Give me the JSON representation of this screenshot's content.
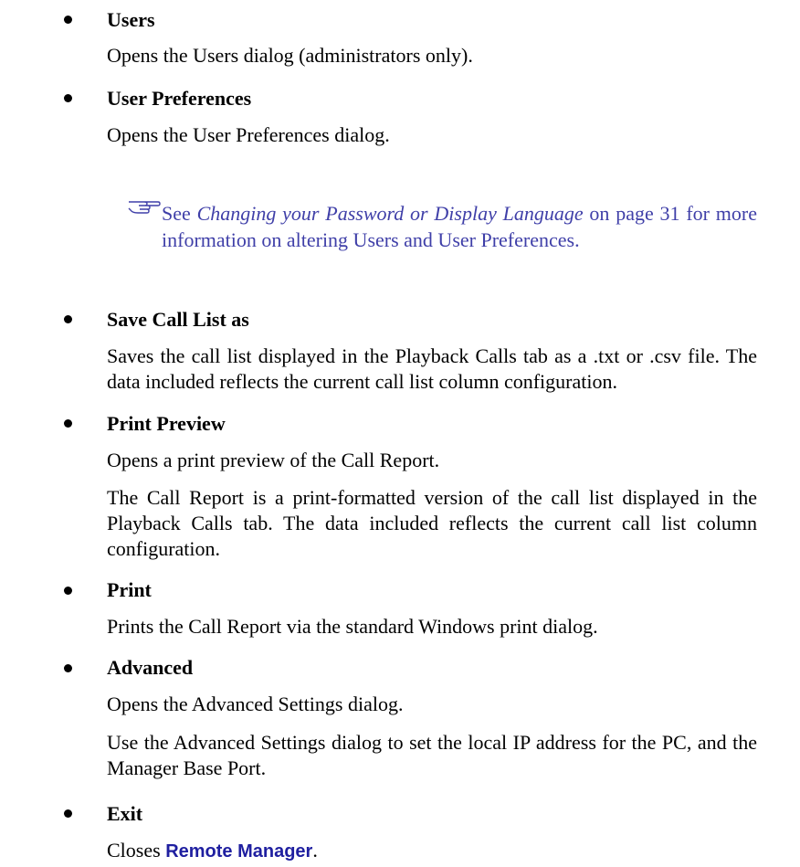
{
  "items": [
    {
      "title": "Users",
      "paragraphs": [
        "Opens the Users dialog (administrators only)."
      ]
    },
    {
      "title": "User Preferences",
      "paragraphs": [
        "Opens the User Preferences dialog."
      ]
    },
    {
      "title": "Save Call List as",
      "paragraphs": [
        "Saves the call list displayed in the Playback Calls tab as a .txt or .csv file. The data included reflects the current call list column configuration."
      ]
    },
    {
      "title": "Print Preview",
      "paragraphs": [
        "Opens a print preview of the Call Report.",
        "The Call Report is a print-formatted version of the call list displayed in the Playback Calls tab. The data included reflects the current call list column configuration."
      ]
    },
    {
      "title": "Print",
      "paragraphs": [
        "Prints the Call Report via the standard Windows print dialog."
      ]
    },
    {
      "title": "Advanced",
      "paragraphs": [
        "Opens the Advanced Settings dialog.",
        "Use the Advanced Settings dialog to set the local IP address for the PC, and the Manager Base Port."
      ]
    },
    {
      "title": "Exit",
      "paragraphs": []
    }
  ],
  "note": {
    "prefix": "See ",
    "link_text": "Changing your Password or Display Language",
    "suffix": " on page 31 for more information on altering Users and User Preferences.",
    "icon": "pointing-hand-icon",
    "color": "#3f3fa8"
  },
  "exit_desc": {
    "prefix": "Closes ",
    "app_name": "Remote Manager",
    "suffix": ".",
    "app_color": "#1f1fa0"
  }
}
